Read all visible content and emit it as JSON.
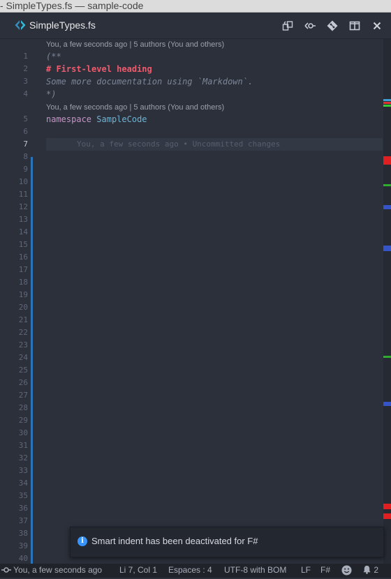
{
  "window": {
    "title": "- SimpleTypes.fs — sample-code"
  },
  "tab": {
    "label": "SimpleTypes.fs"
  },
  "actions": [
    "split-compare-icon",
    "open-changes-icon",
    "git-compare-icon",
    "split-editor-icon",
    "close-icon"
  ],
  "editor": {
    "line_numbers": [
      "1",
      "2",
      "3",
      "4",
      "5",
      "6",
      "7",
      "8",
      "9",
      "10",
      "11",
      "12",
      "13",
      "14",
      "15",
      "16",
      "17",
      "18",
      "19",
      "20",
      "21",
      "22",
      "23",
      "24",
      "25",
      "26",
      "27",
      "28",
      "29",
      "30",
      "31",
      "32",
      "33",
      "34",
      "35",
      "36",
      "37",
      "38",
      "39",
      "40"
    ],
    "codelens_1": "You, a few seconds ago | 5 authors (You and others)",
    "codelens_2": "You, a few seconds ago | 5 authors (You and others)",
    "line1": "(**",
    "line2": "# First-level heading",
    "line3": "Some more documentation using `Markdown`.",
    "line4": "*)",
    "line5_kw": "namespace",
    "line5_id": "SampleCode",
    "blame": "You, a few seconds ago • Uncommitted changes",
    "active_line": "7"
  },
  "notification": {
    "message": "Smart indent has been deactivated for F#"
  },
  "statusbar": {
    "blame": "You, a few seconds ago",
    "position": "Li 7, Col 1",
    "indent": "Espaces : 4",
    "encoding": "UTF-8 with BOM",
    "eol": "LF",
    "language": "F#",
    "notifications_count": "2"
  },
  "colors": {
    "background": "#2b303b",
    "dirty_bar": "#2a73b8",
    "heading": "#f05a6d",
    "keyword": "#c594c5",
    "identifier": "#6fb3d2",
    "info": "#3794ff"
  }
}
